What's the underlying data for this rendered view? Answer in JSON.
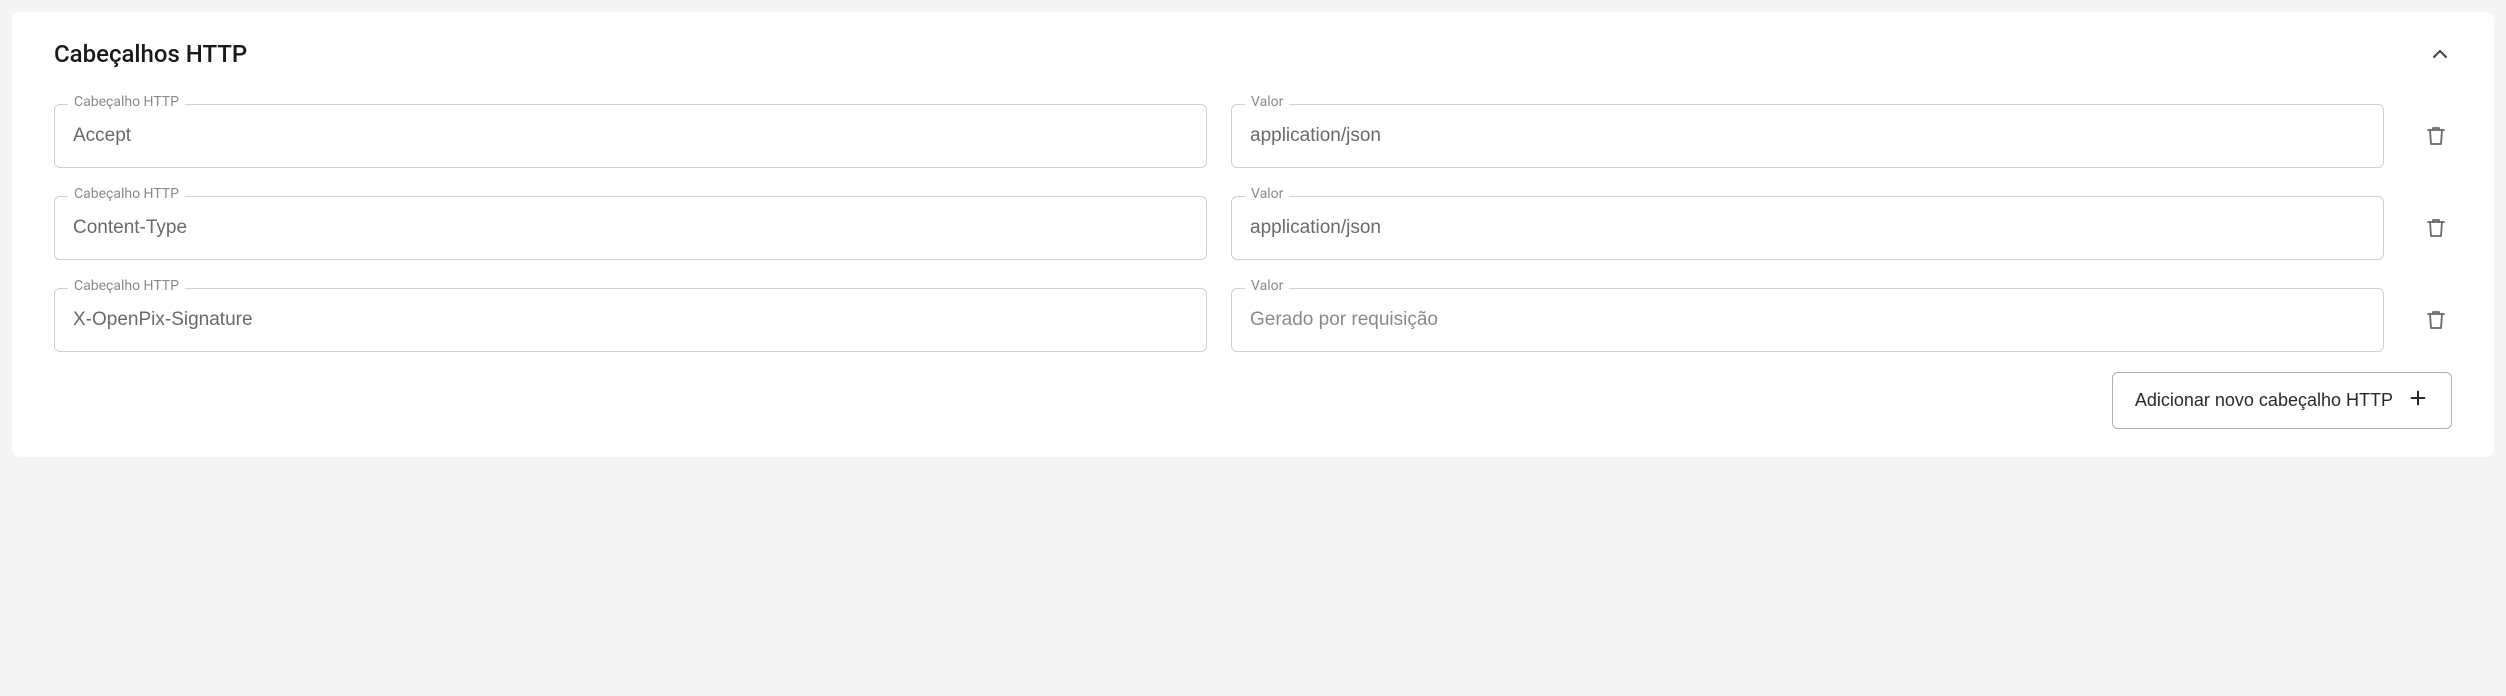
{
  "section": {
    "title": "Cabeçalhos HTTP"
  },
  "labels": {
    "header": "Cabeçalho HTTP",
    "value": "Valor"
  },
  "rows": [
    {
      "header": "Accept",
      "value": "application/json",
      "placeholder": ""
    },
    {
      "header": "Content-Type",
      "value": "application/json",
      "placeholder": ""
    },
    {
      "header": "X-OpenPix-Signature",
      "value": "",
      "placeholder": "Gerado por requisição"
    }
  ],
  "actions": {
    "add": "Adicionar novo cabeçalho HTTP"
  }
}
